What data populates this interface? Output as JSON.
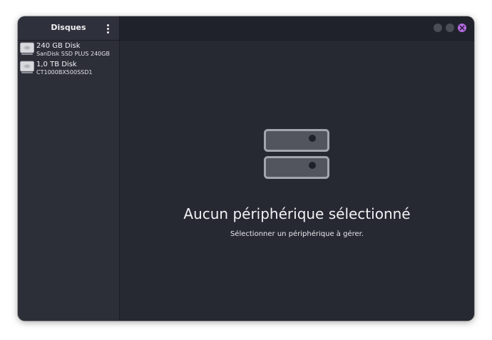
{
  "sidebar": {
    "title": "Disques",
    "menu_icon": "vertical-ellipsis-icon",
    "disks": [
      {
        "name": "240 GB Disk",
        "model": "SanDisk SSD PLUS 240GB",
        "icon": "drive-icon"
      },
      {
        "name": "1,0 TB Disk",
        "model": "CT1000BX500SSD1",
        "icon": "drive-icon"
      }
    ]
  },
  "window_controls": {
    "minimize_icon": "minimize-icon",
    "maximize_icon": "maximize-icon",
    "close_icon": "close-icon",
    "close_color": "#b56be0"
  },
  "main": {
    "icon": "storage-drives-icon",
    "title": "Aucun périphérique sélectionné",
    "subtitle": "Sélectionner un périphérique à gérer."
  },
  "colors": {
    "window_bg": "#262832",
    "sidebar_bg": "#2c2e38",
    "header_bg": "#20222b",
    "accent": "#b56be0"
  }
}
